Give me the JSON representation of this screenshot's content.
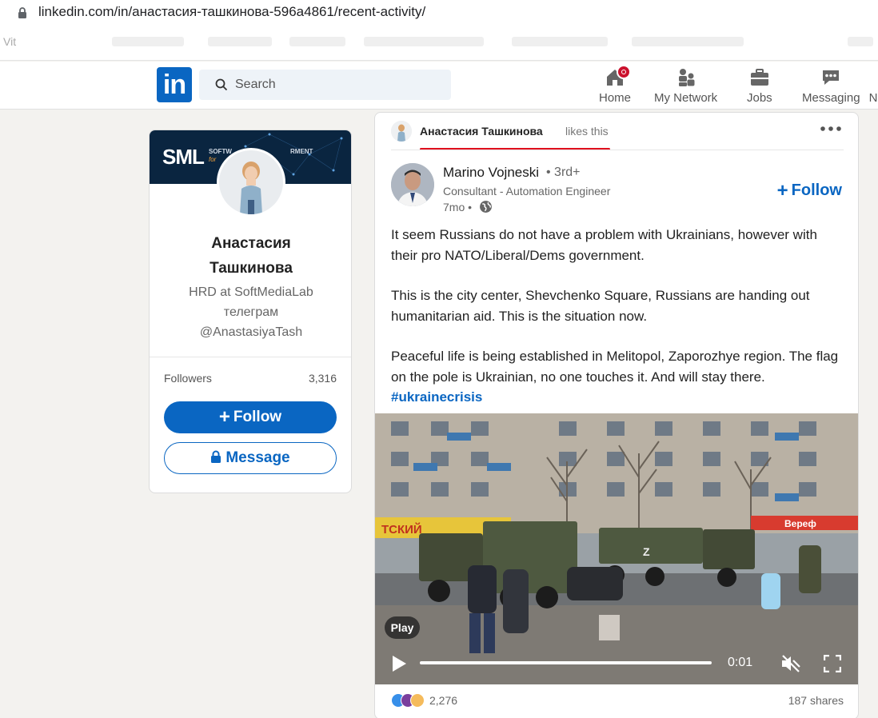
{
  "browser": {
    "url": "linkedin.com/in/анастасия-ташкинова-596a4861/recent-activity/",
    "bookmark_visible": "Vit"
  },
  "nav": {
    "search_placeholder": "Search",
    "items": [
      {
        "label": "Home",
        "icon": "home-icon"
      },
      {
        "label": "My Network",
        "icon": "network-icon"
      },
      {
        "label": "Jobs",
        "icon": "jobs-icon"
      },
      {
        "label": "Messaging",
        "icon": "messaging-icon"
      },
      {
        "label": "N",
        "icon": "notifications-icon"
      }
    ],
    "brand_color": "#0a66c2"
  },
  "profile": {
    "banner_logo": "SML",
    "banner_sub": "SOFTW",
    "banner_sub_right": "RMENT",
    "banner_sub2": "for",
    "name": "Анастасия Ташкинова",
    "headline_lines": [
      "HRD at SoftMediaLab",
      "телеграм",
      "@AnastasiyaTash"
    ],
    "followers_label": "Followers",
    "followers_value": "3,316",
    "follow_label": "Follow",
    "message_label": "Message"
  },
  "post": {
    "liker_name": "Анастасия Ташкинова",
    "likes_suffix": "likes this",
    "author_name": "Marino Vojneski",
    "author_degree": "• 3rd+",
    "author_title": "Consultant - Automation Engineer",
    "time": "7mo •",
    "follow_label": "Follow",
    "paragraphs": [
      "It seem Russians do not have a problem with Ukrainians, however with their pro NATO/Liberal/Dems government.",
      "This is the city center, Shevchenko Square, Russians are handing out humanitarian aid. This is the situation now.",
      "Peaceful life is being established in Melitopol, Zaporozhye region. The flag on the pole is Ukrainian, no one touches it. And will stay there."
    ],
    "hashtag": "#ukrainecrisis",
    "video": {
      "play_badge": "Play",
      "time": "0:01",
      "sign_left": "ТСКИЙ",
      "sign_right": "Вереф"
    },
    "reactions_count": "2,276",
    "shares": "187 shares"
  }
}
